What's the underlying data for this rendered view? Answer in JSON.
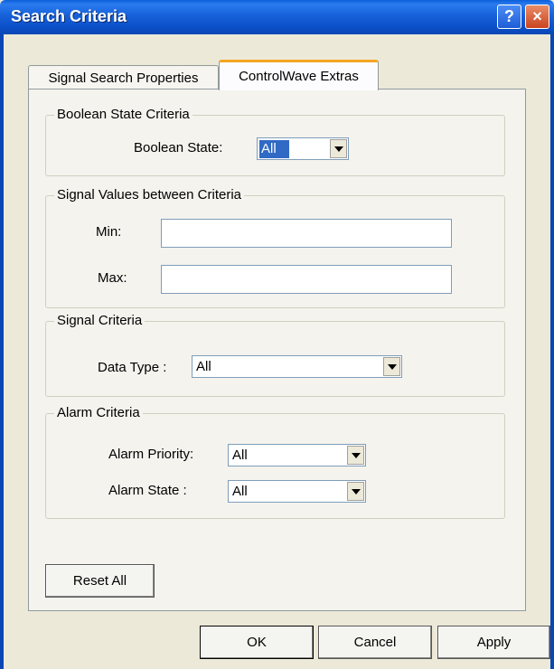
{
  "window": {
    "title": "Search Criteria",
    "help_label": "?",
    "close_label": "×"
  },
  "tabs": [
    {
      "label": "Signal Search Properties",
      "active": false
    },
    {
      "label": "ControlWave Extras",
      "active": true
    }
  ],
  "boolean_group": {
    "legend": "Boolean State Criteria",
    "state_label": "Boolean State:",
    "state_value": "All"
  },
  "values_group": {
    "legend": "Signal Values between Criteria",
    "min_label": "Min:",
    "min_value": "",
    "max_label": "Max:",
    "max_value": ""
  },
  "signal_group": {
    "legend": "Signal Criteria",
    "data_type_label": "Data Type :",
    "data_type_value": "All"
  },
  "alarm_group": {
    "legend": "Alarm Criteria",
    "priority_label": "Alarm Priority:",
    "priority_value": "All",
    "state_label": "Alarm State :",
    "state_value": "All"
  },
  "buttons": {
    "reset_all": "Reset All",
    "ok": "OK",
    "cancel": "Cancel",
    "apply": "Apply"
  },
  "colors": {
    "titlebar": "#0A47B5",
    "dialog_bg": "#ECE9D8",
    "selection": "#316AC5",
    "tab_highlight": "#F5A623"
  }
}
